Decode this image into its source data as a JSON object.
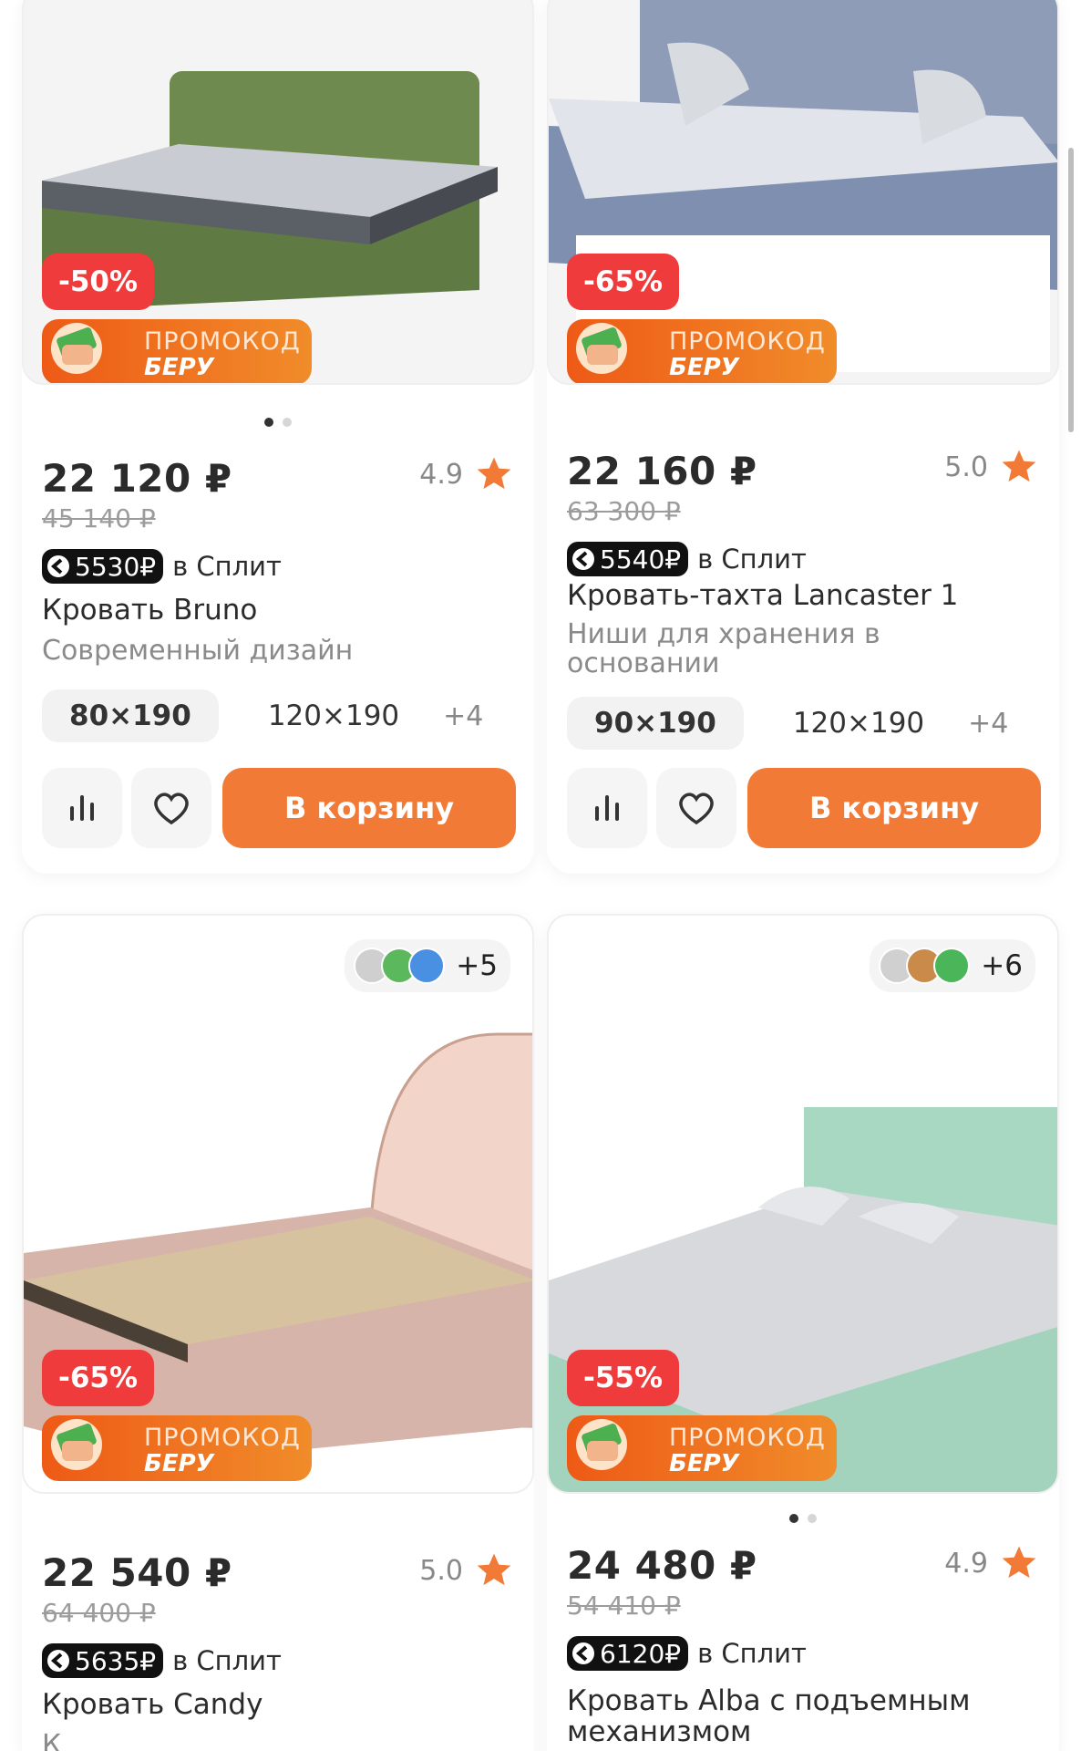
{
  "products": [
    {
      "discount": "-50%",
      "promo_label": "ПРОМОКОД",
      "promo_code": "БЕРУ",
      "price": "22 120 ₽",
      "old_price": "45 140 ₽",
      "rating": "4.9",
      "split_amount": "5530₽",
      "split_text": "в Сплит",
      "title": "Кровать Bruno",
      "subtitle": "Современный дизайн",
      "sizes": [
        "80×190",
        "120×190"
      ],
      "sizes_more": "+4",
      "cart_label": "В корзину"
    },
    {
      "discount": "-65%",
      "promo_label": "ПРОМОКОД",
      "promo_code": "БЕРУ",
      "price": "22 160 ₽",
      "old_price": "63 300 ₽",
      "rating": "5.0",
      "split_amount": "5540₽",
      "split_text": "в Сплит",
      "title": "Кровать-тахта Lancaster 1",
      "subtitle": "Ниши для хранения в основании",
      "sizes": [
        "90×190",
        "120×190"
      ],
      "sizes_more": "+4",
      "cart_label": "В корзину"
    },
    {
      "discount": "-65%",
      "promo_label": "ПРОМОКОД",
      "promo_code": "БЕРУ",
      "colors_more": "+5",
      "colors": [
        "#cfcfcf",
        "#5cb85c",
        "#4a90e2"
      ],
      "price": "22 540 ₽",
      "old_price": "64 400 ₽",
      "rating": "5.0",
      "split_amount": "5635₽",
      "split_text": "в Сплит",
      "title": "Кровать Candy",
      "subtitle": "К"
    },
    {
      "discount": "-55%",
      "promo_label": "ПРОМОКОД",
      "promo_code": "БЕРУ",
      "colors_more": "+6",
      "colors": [
        "#d0d0d0",
        "#c98a4a",
        "#4bb55a"
      ],
      "price": "24 480 ₽",
      "old_price": "54 410 ₽",
      "rating": "4.9",
      "split_amount": "6120₽",
      "split_text": "в Сплит",
      "title": "Кровать Alba с подъемным механизмом"
    }
  ],
  "colors": {
    "accent": "#f07a36",
    "discount": "#ef3b3b",
    "star": "#f07a36"
  }
}
